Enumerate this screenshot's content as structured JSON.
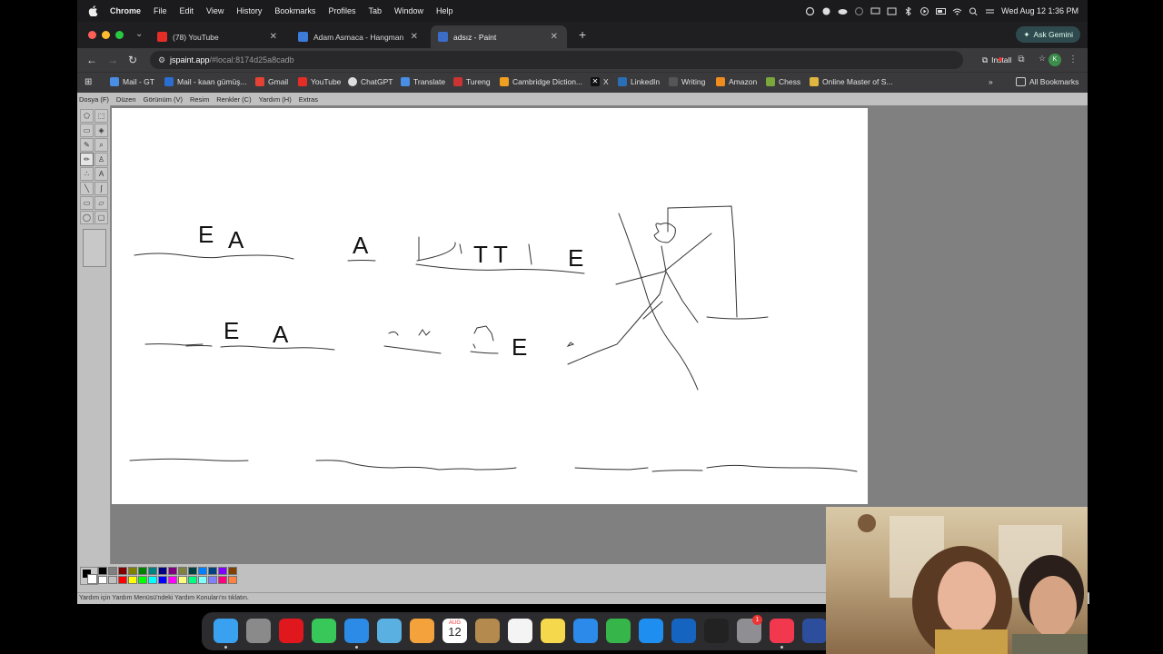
{
  "menubar": {
    "app": "Chrome",
    "items": [
      "File",
      "Edit",
      "View",
      "History",
      "Bookmarks",
      "Profiles",
      "Tab",
      "Window",
      "Help"
    ],
    "clock": "Wed Aug 12  1:36 PM"
  },
  "tabs": [
    {
      "title": "(78) YouTube",
      "color": "#e52d27"
    },
    {
      "title": "Adam Asmaca - Hangman",
      "color": "#3d7bd8"
    },
    {
      "title": "adsız - Paint",
      "color": "#3b6cc6"
    }
  ],
  "gemini_label": "Ask Gemini",
  "url": {
    "host": "jspaint.app",
    "path": "/#local:8174d25a8cadb"
  },
  "install_label": "Install",
  "profile_initial": "K",
  "bookmarks": [
    {
      "label": "Mail - GT",
      "color": "#4a8de4"
    },
    {
      "label": "Mail - kaan gümüş...",
      "color": "#2b6dd0"
    },
    {
      "label": "Gmail",
      "color": "#e44235"
    },
    {
      "label": "YouTube",
      "color": "#e52d27"
    },
    {
      "label": "ChatGPT",
      "color": "#dddddd"
    },
    {
      "label": "Translate",
      "color": "#4a8de4"
    },
    {
      "label": "Tureng",
      "color": "#c33"
    },
    {
      "label": "Cambridge Diction...",
      "color": "#f0a020"
    },
    {
      "label": "X",
      "color": "#111111"
    },
    {
      "label": "LinkedIn",
      "color": "#2a6fb5"
    },
    {
      "label": "Writing",
      "color": "#555555"
    },
    {
      "label": "Amazon",
      "color": "#f08c1e"
    },
    {
      "label": "Chess",
      "color": "#7aa63c"
    },
    {
      "label": "Online Master of S...",
      "color": "#e0b640"
    }
  ],
  "all_bookmarks": "All Bookmarks",
  "paint": {
    "menu": [
      "Dosya (F)",
      "Düzen",
      "Görünüm (V)",
      "Resim",
      "Renkler (C)",
      "Yardım (H)",
      "Extras"
    ],
    "status": "Yardım için Yardım Menüsü'ndeki Yardım Konuları'nı tıklatın.",
    "palette": [
      "#000000",
      "#808080",
      "#800000",
      "#808000",
      "#008000",
      "#008080",
      "#000080",
      "#800080",
      "#808040",
      "#004040",
      "#0080ff",
      "#004080",
      "#8000ff",
      "#804000",
      "#ffffff",
      "#c0c0c0",
      "#ff0000",
      "#ffff00",
      "#00ff00",
      "#00ffff",
      "#0000ff",
      "#ff00ff",
      "#ffff80",
      "#00ff80",
      "#80ffff",
      "#8080ff",
      "#ff0080",
      "#ff8040"
    ],
    "canvas_letters": [
      {
        "text": "E",
        "row": 1
      },
      {
        "text": "A",
        "row": 1
      },
      {
        "text": "A",
        "row": 1
      },
      {
        "text": "T",
        "row": 1
      },
      {
        "text": "T",
        "row": 1
      },
      {
        "text": "E",
        "row": 1
      },
      {
        "text": "E",
        "row": 2
      },
      {
        "text": "A",
        "row": 2
      },
      {
        "text": "E",
        "row": 2
      }
    ]
  },
  "dock_apps": [
    {
      "name": "Finder",
      "color": "#3aa0f0"
    },
    {
      "name": "Launchpad",
      "color": "#8a8a8a"
    },
    {
      "name": "Opera",
      "color": "#e1171e"
    },
    {
      "name": "Messages",
      "color": "#38c85a"
    },
    {
      "name": "Safari",
      "color": "#2b8be6"
    },
    {
      "name": "Maps",
      "color": "#5ab0e0"
    },
    {
      "name": "Photos",
      "color": "#f4a23c"
    },
    {
      "name": "Calendar",
      "color": "#ffffff"
    },
    {
      "name": "Contacts",
      "color": "#b58a4e"
    },
    {
      "name": "Reminders",
      "color": "#f4f4f4"
    },
    {
      "name": "Notes",
      "color": "#f6d84c"
    },
    {
      "name": "Keynote",
      "color": "#2c8bea"
    },
    {
      "name": "Numbers",
      "color": "#35b54a"
    },
    {
      "name": "App Store",
      "color": "#1f8ef1"
    },
    {
      "name": "Outlook",
      "color": "#1565c0"
    },
    {
      "name": "Terminal",
      "color": "#222222"
    },
    {
      "name": "System Settings",
      "color": "#8e8e93"
    },
    {
      "name": "Music",
      "color": "#f2384f"
    },
    {
      "name": "Other",
      "color": "#2c4e9c"
    }
  ],
  "dock_calendar": {
    "month": "AUG",
    "day": "12"
  },
  "dock_badge": "1"
}
